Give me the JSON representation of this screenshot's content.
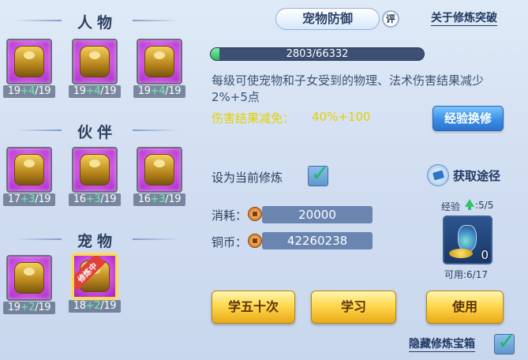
{
  "left": {
    "sections": [
      {
        "title": "人物",
        "slots": [
          {
            "base": "19",
            "bonus": "+4",
            "max": "/19"
          },
          {
            "base": "19",
            "bonus": "+4",
            "max": "/19"
          },
          {
            "base": "19",
            "bonus": "+4",
            "max": "/19"
          }
        ]
      },
      {
        "title": "伙伴",
        "slots": [
          {
            "base": "17",
            "bonus": "+3",
            "max": "/19"
          },
          {
            "base": "16",
            "bonus": "+3",
            "max": "/19"
          },
          {
            "base": "16",
            "bonus": "+3",
            "max": "/19"
          }
        ]
      },
      {
        "title": "宠物",
        "slots": [
          {
            "base": "19",
            "bonus": "+2",
            "max": "/19"
          },
          {
            "base": "18",
            "bonus": "+2",
            "max": "/19",
            "tag": "修炼中"
          }
        ]
      }
    ]
  },
  "header": {
    "tab_label": "宠物防御",
    "rate_badge": "评",
    "about_link": "关于修炼突破"
  },
  "exp": {
    "text": "2803/66332",
    "current": 2803,
    "max": 66332
  },
  "description": "每级可使宠物和子女受到的物理、法术伤害结果减少2%+5点",
  "reduction": {
    "label": "伤害结果减免：",
    "value": "40%+100"
  },
  "exchange_button": "经验换修",
  "set_current": {
    "label": "设为当前修炼",
    "checked": true
  },
  "obtain": {
    "label": "获取途径"
  },
  "cost": {
    "label": "消耗：",
    "value": "20000"
  },
  "coins": {
    "label": "铜币：",
    "value": "42260238"
  },
  "item": {
    "exp_label": "经验",
    "exp_count": ":5/5",
    "quantity": "0",
    "usable": "可用:6/17"
  },
  "buttons": {
    "learn50": "学五十次",
    "learn": "学习",
    "use": "使用"
  },
  "hide_chest": {
    "label": "隐藏修炼宝箱",
    "checked": true
  },
  "colors": {
    "accent_green": "#31c26a",
    "gold_text": "#e2d000",
    "tile_purple": "#d65ee9"
  }
}
